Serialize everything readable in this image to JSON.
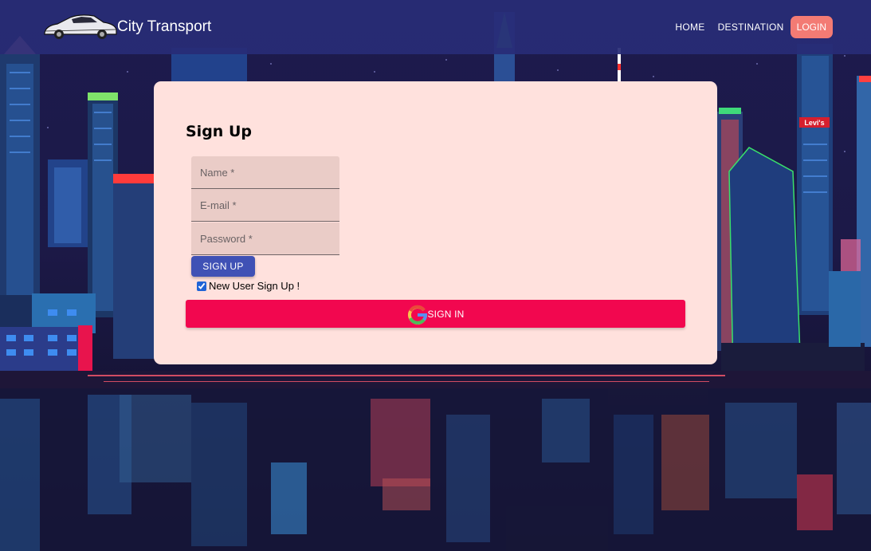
{
  "navbar": {
    "brand_name": "City Transport",
    "links": [
      "HOME",
      "DESTINATION"
    ],
    "login_label": "LOGIN"
  },
  "form": {
    "title": "Sign Up",
    "name_placeholder": "Name *",
    "email_placeholder": "E-mail *",
    "password_placeholder": "Password *",
    "signup_label": "SIGN UP",
    "new_user_label": "New User Sign Up !",
    "new_user_checked": true,
    "google_label": "SIGN IN"
  },
  "background": {
    "billboard_text": "Levi's"
  },
  "colors": {
    "navbar": "#282c76",
    "login_button": "#f37b74",
    "card": "#ffe1dd",
    "signup_button": "#3f51b5",
    "google_button": "#f2074f"
  }
}
